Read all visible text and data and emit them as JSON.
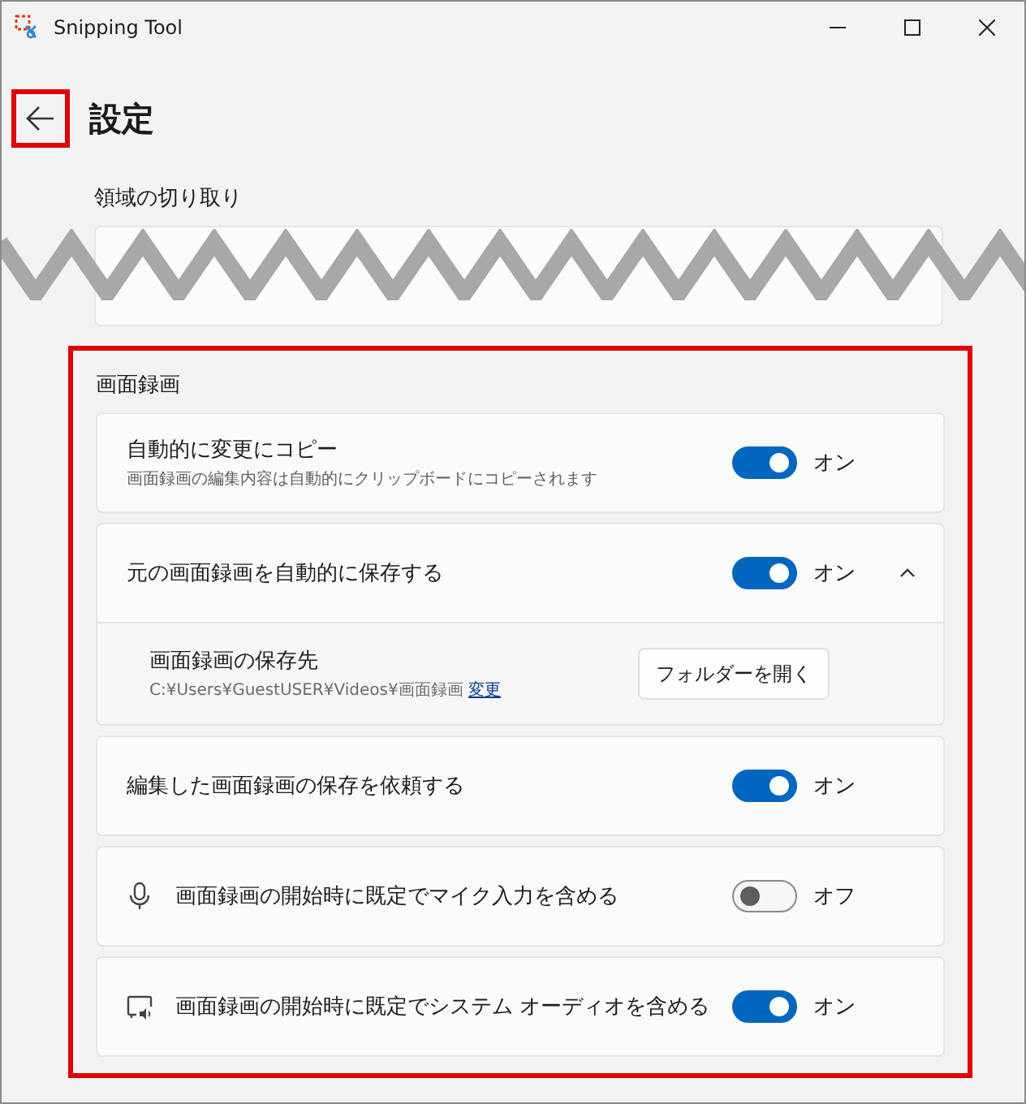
{
  "window": {
    "title": "Snipping Tool"
  },
  "header": {
    "back_highlighted": true,
    "title": "設定"
  },
  "region_section": {
    "title": "領域の切り取り",
    "torn": true
  },
  "recording_section": {
    "title": "画面録画",
    "highlighted": true,
    "settings": [
      {
        "kind": "plain",
        "label": "自動的に変更にコピー",
        "description": "画面録画の編集内容は自動的にクリップボードにコピーされます",
        "on": true,
        "state_text": "オン"
      },
      {
        "kind": "plain",
        "label": "元の画面録画を自動的に保存する",
        "on": true,
        "state_text": "オン",
        "expanded": true,
        "detail": {
          "label": "画面録画の保存先",
          "path": "C:¥Users¥GuestUSER¥Videos¥画面録画",
          "link": "変更",
          "button": "フォルダーを開く"
        }
      },
      {
        "kind": "plain",
        "label": "編集した画面録画の保存を依頼する",
        "on": true,
        "state_text": "オン"
      },
      {
        "kind": "mic",
        "label": "画面録画の開始時に既定でマイク入力を含める",
        "on": false,
        "state_text": "オフ"
      },
      {
        "kind": "system-audio",
        "label": "画面録画の開始時に既定でシステム オーディオを含める",
        "on": true,
        "state_text": "オン"
      }
    ]
  }
}
